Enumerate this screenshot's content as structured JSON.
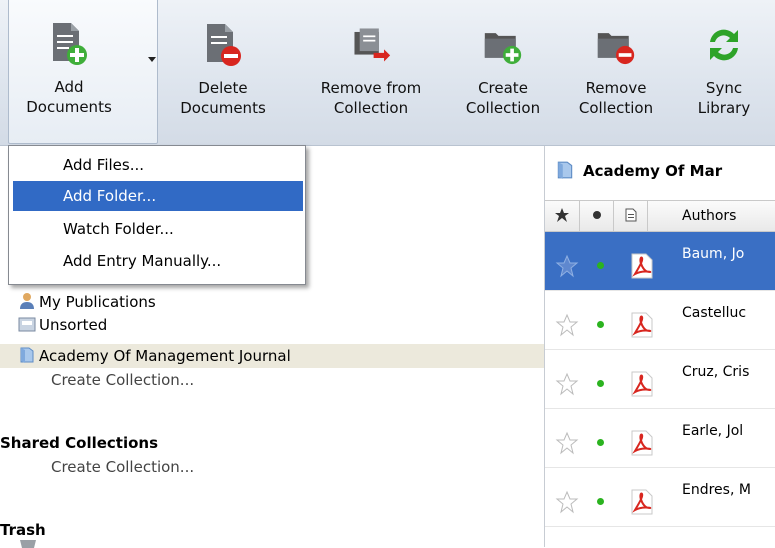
{
  "toolbar": {
    "add": {
      "line1": "Add",
      "line2": "Documents"
    },
    "delete": {
      "line1": "Delete",
      "line2": "Documents"
    },
    "remove_from": {
      "line1": "Remove from",
      "line2": "Collection"
    },
    "create": {
      "line1": "Create",
      "line2": "Collection"
    },
    "remove": {
      "line1": "Remove",
      "line2": "Collection"
    },
    "sync": {
      "line1": "Sync",
      "line2": "Library"
    }
  },
  "menu": {
    "items": [
      "Add Files...",
      "Add Folder...",
      "Watch Folder...",
      "Add Entry Manually..."
    ],
    "selected_index": 1
  },
  "tree": {
    "my_publications": "My Publications",
    "unsorted": "Unsorted",
    "academy": "Academy Of Management Journal",
    "create_collection": "Create Collection...",
    "shared_header": "Shared Collections",
    "shared_create": "Create Collection...",
    "trash": "Trash"
  },
  "collection_title": "Academy Of Mar",
  "table": {
    "authors_header": "Authors",
    "rows": [
      "Baum, Jo",
      "Castelluc",
      "Cruz, Cris",
      "Earle, Jol",
      "Endres, M"
    ],
    "selected_index": 0
  },
  "colors": {
    "selection": "#316ac5",
    "read_dot": "#2bb31f",
    "pdf_red": "#d8261f"
  }
}
